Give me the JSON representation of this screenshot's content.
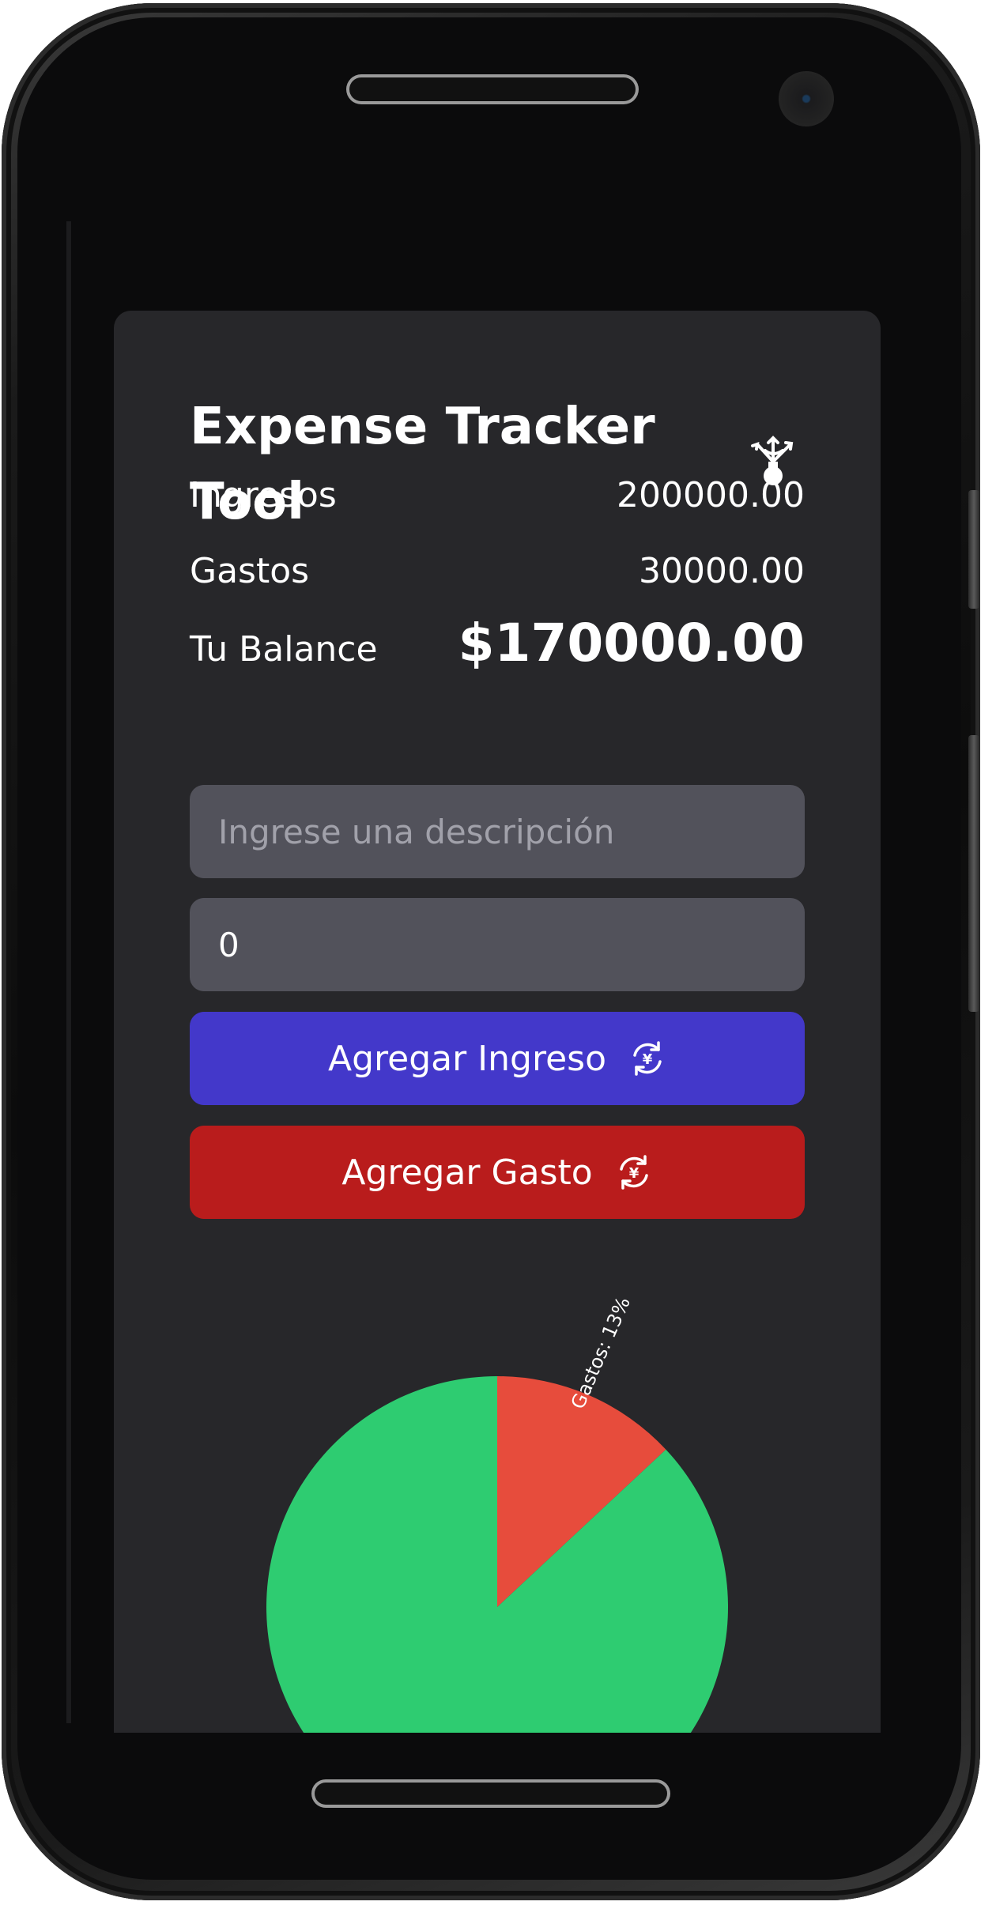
{
  "app": {
    "title": "Expense Tracker Tool",
    "logo_icon": "badminton-shuttlecock-icon"
  },
  "summary": {
    "income_label": "Ingresos",
    "income_value": "200000.00",
    "expense_label": "Gastos",
    "expense_value": "30000.00",
    "balance_label": "Tu Balance",
    "balance_value": "$170000.00"
  },
  "form": {
    "description_placeholder": "Ingrese una descripción",
    "description_value": "",
    "amount_value": "0",
    "add_income_label": "Agregar Ingreso",
    "add_expense_label": "Agregar Gasto",
    "button_icon": "currency-exchange-icon"
  },
  "colors": {
    "card_bg": "#27272a",
    "input_bg": "#52525b",
    "income_button": "#4338ca",
    "expense_button": "#b91c1c",
    "pie_income": "#2ecc71",
    "pie_expense": "#e74c3c"
  },
  "chart_data": {
    "type": "pie",
    "categories": [
      "Ingresos",
      "Gastos"
    ],
    "values": [
      200000,
      30000
    ],
    "slice_labels": [
      "",
      "Gastos: 13%"
    ],
    "colors": [
      "#2ecc71",
      "#e74c3c"
    ]
  }
}
